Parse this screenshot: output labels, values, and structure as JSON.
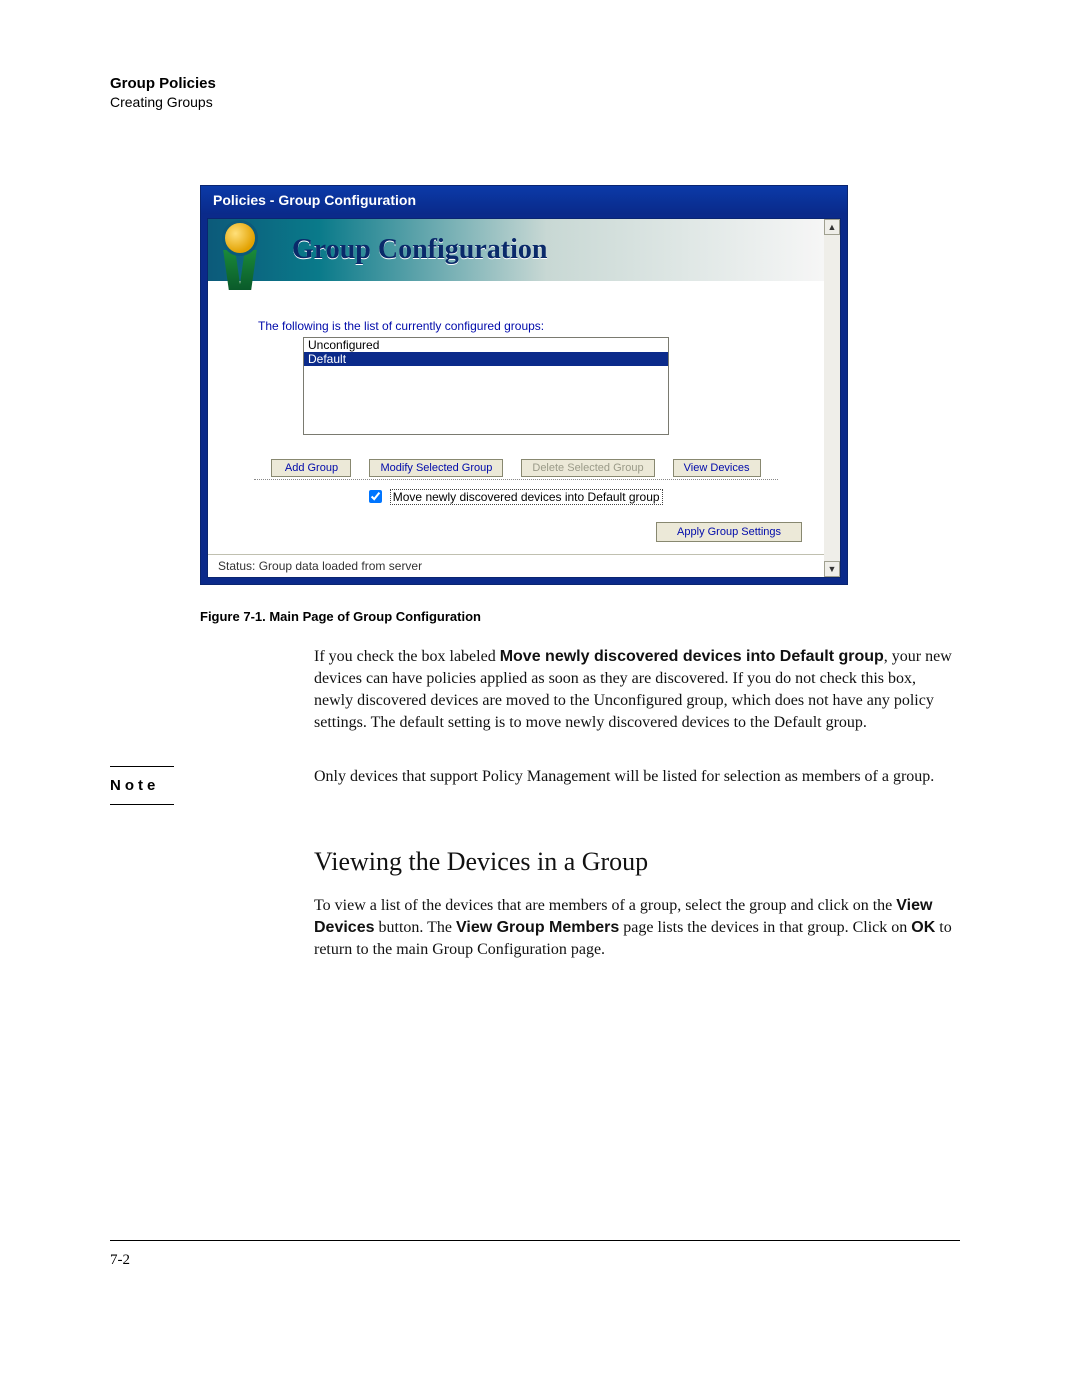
{
  "header": {
    "title": "Group Policies",
    "subtitle": "Creating Groups"
  },
  "figure": {
    "window_title": "Policies - Group Configuration",
    "banner_title": "Group Configuration",
    "intro": "The following is the list of currently configured groups:",
    "groups": [
      "Unconfigured",
      "Default"
    ],
    "selected_index": 1,
    "buttons": {
      "add": "Add Group",
      "modify": "Modify Selected Group",
      "delete": "Delete Selected Group",
      "view": "View Devices"
    },
    "checkbox_label": "Move newly discovered devices into Default group",
    "checkbox_checked": true,
    "apply": "Apply Group Settings",
    "status": "Status:  Group data loaded from server",
    "caption": "Figure 7-1.   Main Page of Group Configuration"
  },
  "para1": {
    "lead": "If you check the box labeled ",
    "bold1": "Move newly discovered devices into Default group",
    "rest": ", your new devices can have policies applied as soon as they are discovered. If you do not check this box, newly discovered devices are moved to the Unconfigured group, which does not have any policy settings. The default setting is to move newly discovered devices to the Default group."
  },
  "note": {
    "label": "Note",
    "text": "Only devices that support Policy Management will be listed for selection as members of a group."
  },
  "section": {
    "heading": "Viewing the Devices in a Group",
    "p_lead": "To view a list of the devices that are members of a group, select the group and click on the ",
    "b1": "View Devices",
    "mid1": " button. The ",
    "b2": "View Group Members",
    "mid2": " page lists the devices in that group. Click on ",
    "b3": "OK",
    "tail": " to return to the main Group Configuration page."
  },
  "page_number": "7-2"
}
